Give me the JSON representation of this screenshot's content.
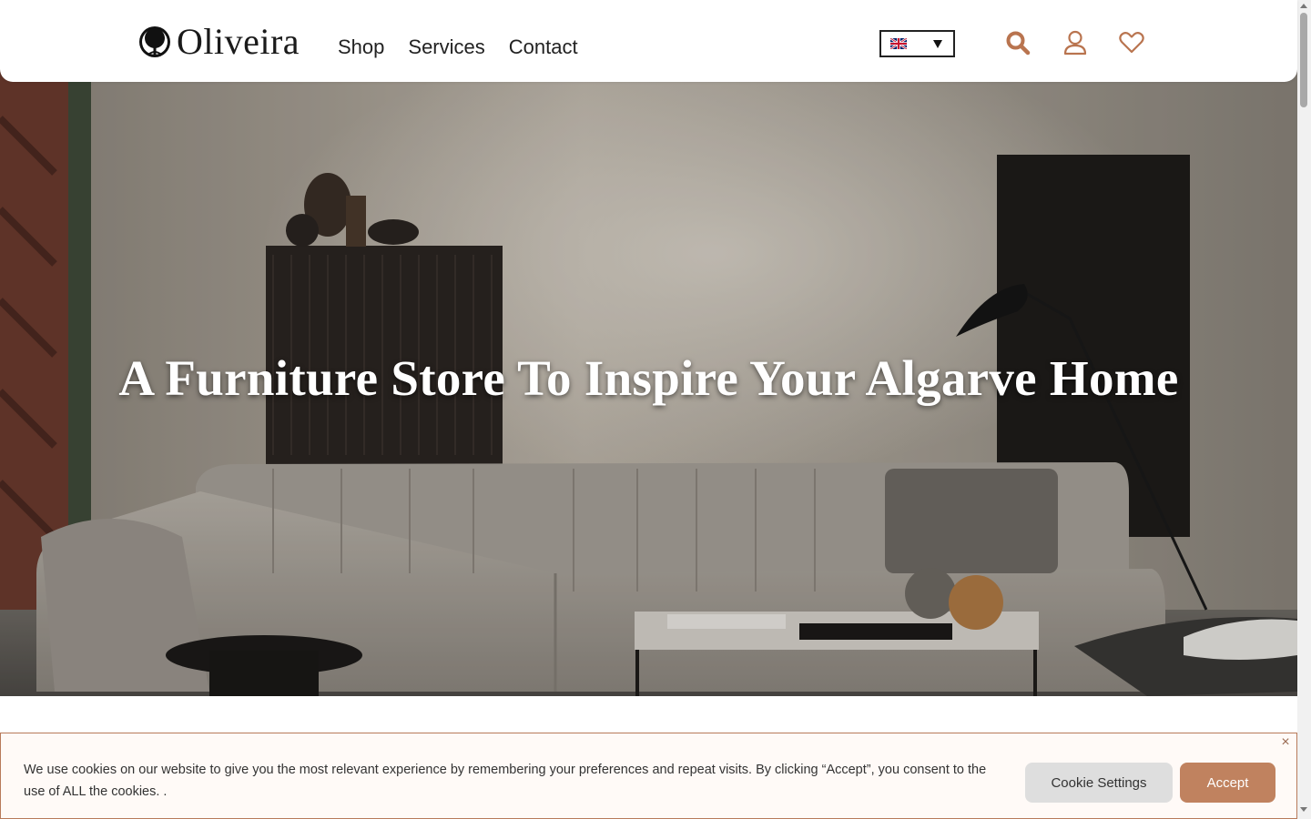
{
  "header": {
    "logo_text": "Oliveira",
    "nav": [
      {
        "label": "Shop"
      },
      {
        "label": "Services"
      },
      {
        "label": "Contact"
      }
    ],
    "language": {
      "selected": "en-GB",
      "flag_icon": "uk-flag-icon"
    },
    "icons": [
      "search-icon",
      "user-icon",
      "heart-icon"
    ],
    "accent_color": "#b9744f"
  },
  "hero": {
    "title": "A Furniture Store To Inspire Your Algarve Home"
  },
  "cookie_banner": {
    "text": "We use cookies on our website to give you the most relevant experience by remembering your preferences and repeat visits. By clicking “Accept”, you consent to the use of ALL the cookies. .",
    "settings_label": "Cookie Settings",
    "accept_label": "Accept",
    "close_label": "×",
    "accept_color": "#c0825f"
  }
}
